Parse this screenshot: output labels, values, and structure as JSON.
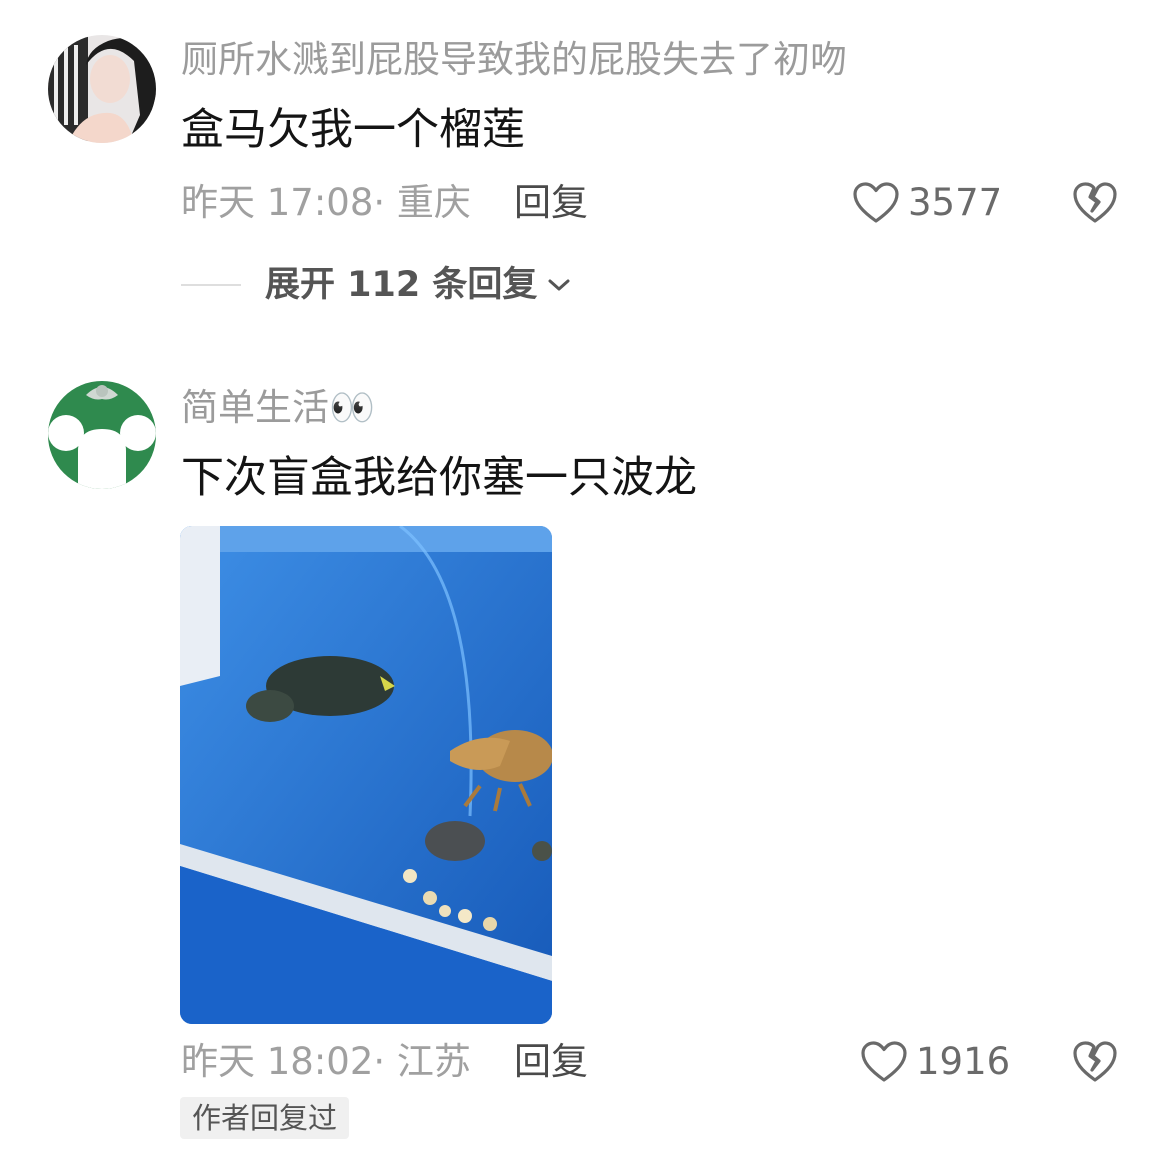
{
  "comments": [
    {
      "username": "厕所水溅到屁股导致我的屁股失去了初吻",
      "text": "盒马欠我一个榴莲",
      "meta": "昨天 17:08· 重庆",
      "reply_label": "回复",
      "likes": "3577",
      "expand_label": "展开 112 条回复"
    },
    {
      "username": "简单生活",
      "username_emoji": "👀",
      "text": "下次盲盒我给你塞一只波龙",
      "meta": "昨天 18:02· 江苏",
      "reply_label": "回复",
      "likes": "1916",
      "tag": "作者回复过"
    }
  ],
  "icons": {
    "like": "heart-outline-icon",
    "dislike": "broken-heart-icon",
    "expand": "chevron-down-icon"
  },
  "colors": {
    "meta_gray": "#a0a0a0",
    "username_gray": "#9b9b9b",
    "avatar2_green": "#2f8a4e",
    "photo_blue": "#1f6fd1"
  }
}
